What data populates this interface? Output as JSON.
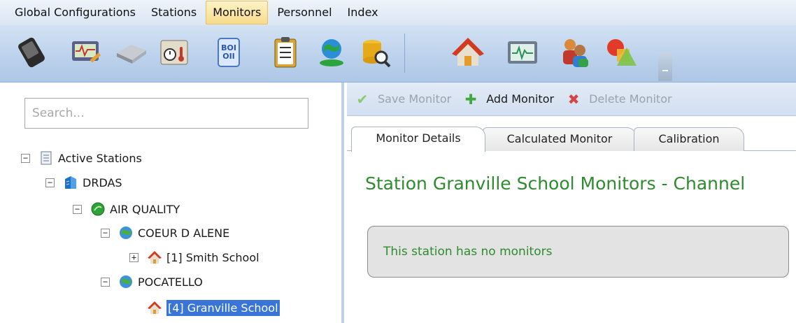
{
  "menubar": {
    "items": [
      {
        "label": "Global Configurations"
      },
      {
        "label": "Stations"
      },
      {
        "label": "Monitors"
      },
      {
        "label": "Personnel"
      },
      {
        "label": "Index"
      }
    ],
    "active": "Monitors"
  },
  "toolbar": {
    "icons": [
      "pda-icon",
      "monitor-edit-icon",
      "hard-drive-icon",
      "clock-temperature-icon",
      "bom-icon",
      "clipboard-icon",
      "epa-globe-icon",
      "database-search-icon",
      "home-icon",
      "waveform-icon",
      "users-icon",
      "shapes-icon"
    ]
  },
  "tree": {
    "search_placeholder": "Search...",
    "nodes": [
      {
        "label": "Active Stations",
        "toggle": "−",
        "icon": "document-icon"
      },
      {
        "label": "DRDAS",
        "toggle": "−",
        "icon": "building-icon"
      },
      {
        "label": "AIR QUALITY",
        "toggle": "−",
        "icon": "green-circle-icon"
      },
      {
        "label": "COEUR D ALENE",
        "toggle": "−",
        "icon": "globe-icon"
      },
      {
        "label": "[1] Smith School",
        "toggle": "+",
        "icon": "home-icon"
      },
      {
        "label": "POCATELLO",
        "toggle": "−",
        "icon": "globe-icon"
      },
      {
        "label": "[4] Granville School",
        "toggle": "",
        "icon": "home-icon",
        "selected": true
      }
    ]
  },
  "actions": {
    "save": "Save Monitor",
    "add": "Add Monitor",
    "delete": "Delete Monitor"
  },
  "tabs": [
    {
      "label": "Monitor Details",
      "active": true
    },
    {
      "label": "Calculated Monitor"
    },
    {
      "label": "Calibration"
    }
  ],
  "content": {
    "title": "Station Granville School Monitors - Channel",
    "message": "This station has no monitors"
  },
  "colors": {
    "accent_green": "#2e8b2e",
    "selection_blue": "#3875d7",
    "menu_active": "#f8db8a"
  }
}
